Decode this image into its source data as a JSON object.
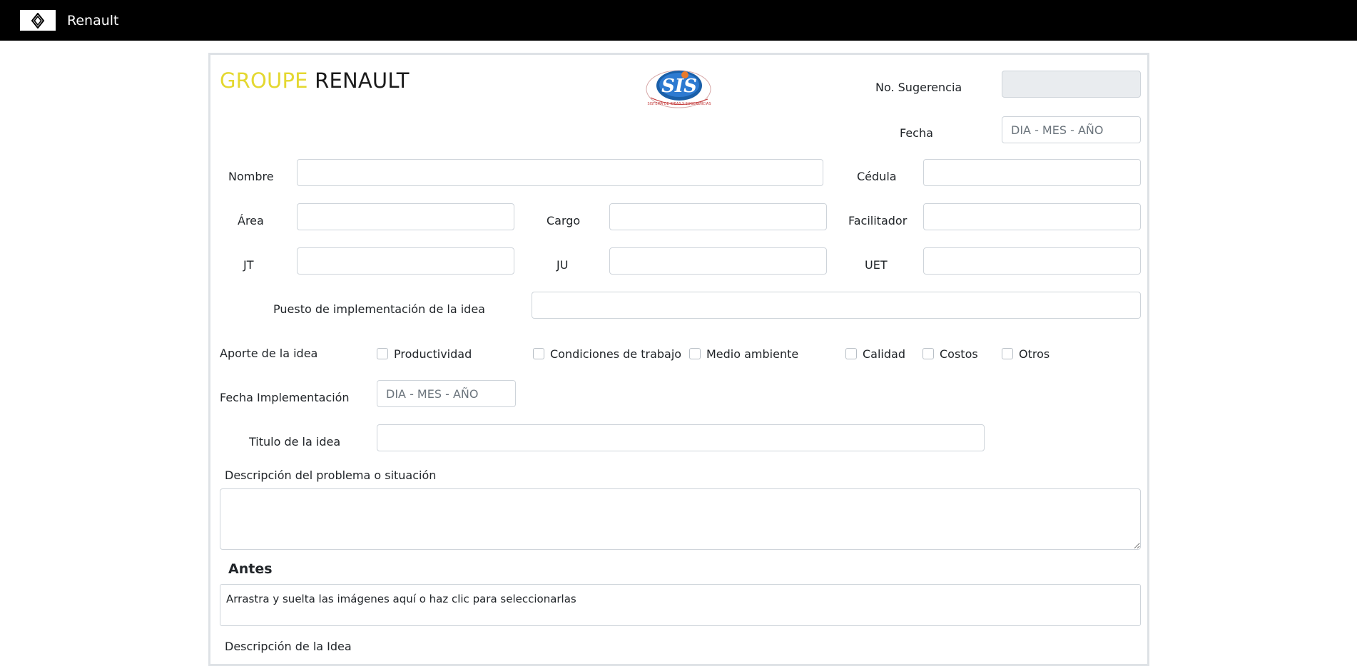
{
  "navbar": {
    "brand": "Renault",
    "logo_icon": "renault-diamond-icon"
  },
  "header": {
    "title_part1": "GROUPE",
    "title_part2": "RENAULT",
    "title_color1": "#e4d830",
    "logo_text": "SIS",
    "logo_subtext": "SISTEMA DE IDEAS Y SUGERENCIAS",
    "suggestion_label": "No. Sugerencia",
    "suggestion_value": "",
    "date_label": "Fecha",
    "date_placeholder": "DIA - MES - AÑO"
  },
  "fields": {
    "nombre": "Nombre",
    "cedula": "Cédula",
    "area": "Área",
    "cargo": "Cargo",
    "facilitador": "Facilitador",
    "jt": "JT",
    "ju": "JU",
    "uet": "UET",
    "puesto": "Puesto de implementación de la idea"
  },
  "aporte": {
    "label": "Aporte de la idea",
    "options": [
      "Productividad",
      "Condiciones de trabajo",
      "Medio ambiente",
      "Calidad",
      "Costos",
      "Otros"
    ]
  },
  "fecha_impl": {
    "label": "Fecha Implementación",
    "placeholder": "DIA - MES - AÑO"
  },
  "titulo": {
    "label": "Titulo de la idea"
  },
  "descripcion_problema": {
    "label": "Descripción del problema o situación"
  },
  "antes": {
    "title": "Antes",
    "dropzone_text": "Arrastra y suelta las imágenes aquí o haz clic para seleccionarlas"
  },
  "descripcion_idea": {
    "label": "Descripción de la Idea"
  }
}
